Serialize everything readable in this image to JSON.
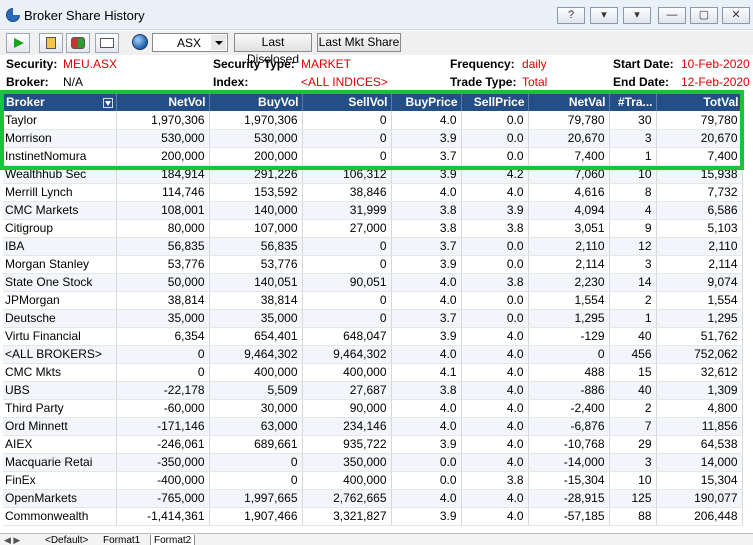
{
  "window": {
    "title": "Broker Share History",
    "buttons": [
      "?",
      "▾",
      "▾",
      "—",
      "▢",
      "✕"
    ]
  },
  "toolbar": {
    "exchange": "ASX",
    "last_disclosed": "Last Disclosed",
    "last_mkt_share": "Last Mkt Share"
  },
  "info": {
    "security_label": "Security:",
    "security": "MEU.ASX",
    "broker_label": "Broker:",
    "broker": "N/A",
    "security_type_label": "Security Type:",
    "security_type": "MARKET",
    "index_label": "Index:",
    "index": "<ALL INDICES>",
    "frequency_label": "Frequency:",
    "frequency": "daily",
    "trade_type_label": "Trade Type:",
    "trade_type": "Total",
    "start_date_label": "Start Date:",
    "start_date": "10-Feb-2020",
    "end_date_label": "End Date:",
    "end_date": "12-Feb-2020"
  },
  "table": {
    "columns": [
      "Broker",
      "NetVol",
      "BuyVol",
      "SellVol",
      "BuyPrice",
      "SellPrice",
      "NetVal",
      "#Tra...",
      "TotVal"
    ],
    "rows": [
      [
        "Taylor",
        "1,970,306",
        "1,970,306",
        "0",
        "4.0",
        "0.0",
        "79,780",
        "30",
        "79,780"
      ],
      [
        "Morrison",
        "530,000",
        "530,000",
        "0",
        "3.9",
        "0.0",
        "20,670",
        "3",
        "20,670"
      ],
      [
        "InstinetNomura",
        "200,000",
        "200,000",
        "0",
        "3.7",
        "0.0",
        "7,400",
        "1",
        "7,400"
      ],
      [
        "Wealthhub Sec",
        "184,914",
        "291,226",
        "106,312",
        "3.9",
        "4.2",
        "7,060",
        "10",
        "15,938"
      ],
      [
        "Merrill Lynch",
        "114,746",
        "153,592",
        "38,846",
        "4.0",
        "4.0",
        "4,616",
        "8",
        "7,732"
      ],
      [
        "CMC Markets",
        "108,001",
        "140,000",
        "31,999",
        "3.8",
        "3.9",
        "4,094",
        "4",
        "6,586"
      ],
      [
        "Citigroup",
        "80,000",
        "107,000",
        "27,000",
        "3.8",
        "3.8",
        "3,051",
        "9",
        "5,103"
      ],
      [
        "IBA",
        "56,835",
        "56,835",
        "0",
        "3.7",
        "0.0",
        "2,110",
        "12",
        "2,110"
      ],
      [
        "Morgan Stanley",
        "53,776",
        "53,776",
        "0",
        "3.9",
        "0.0",
        "2,114",
        "3",
        "2,114"
      ],
      [
        "State One Stock",
        "50,000",
        "140,051",
        "90,051",
        "4.0",
        "3.8",
        "2,230",
        "14",
        "9,074"
      ],
      [
        "JPMorgan",
        "38,814",
        "38,814",
        "0",
        "4.0",
        "0.0",
        "1,554",
        "2",
        "1,554"
      ],
      [
        "Deutsche",
        "35,000",
        "35,000",
        "0",
        "3.7",
        "0.0",
        "1,295",
        "1",
        "1,295"
      ],
      [
        "Virtu Financial",
        "6,354",
        "654,401",
        "648,047",
        "3.9",
        "4.0",
        "-129",
        "40",
        "51,762"
      ],
      [
        "<ALL BROKERS>",
        "0",
        "9,464,302",
        "9,464,302",
        "4.0",
        "4.0",
        "0",
        "456",
        "752,062"
      ],
      [
        "CMC Mkts",
        "0",
        "400,000",
        "400,000",
        "4.1",
        "4.0",
        "488",
        "15",
        "32,612"
      ],
      [
        "UBS",
        "-22,178",
        "5,509",
        "27,687",
        "3.8",
        "4.0",
        "-886",
        "40",
        "1,309"
      ],
      [
        "Third Party",
        "-60,000",
        "30,000",
        "90,000",
        "4.0",
        "4.0",
        "-2,400",
        "2",
        "4,800"
      ],
      [
        "Ord Minnett",
        "-171,146",
        "63,000",
        "234,146",
        "4.0",
        "4.0",
        "-6,876",
        "7",
        "11,856"
      ],
      [
        "AIEX",
        "-246,061",
        "689,661",
        "935,722",
        "3.9",
        "4.0",
        "-10,768",
        "29",
        "64,538"
      ],
      [
        "Macquarie Retai",
        "-350,000",
        "0",
        "350,000",
        "0.0",
        "4.0",
        "-14,000",
        "3",
        "14,000"
      ],
      [
        "FinEx",
        "-400,000",
        "0",
        "400,000",
        "0.0",
        "3.8",
        "-15,304",
        "10",
        "15,304"
      ],
      [
        "OpenMarkets",
        "-765,000",
        "1,997,665",
        "2,762,665",
        "4.0",
        "4.0",
        "-28,915",
        "125",
        "190,077"
      ],
      [
        "Commonwealth",
        "-1,414,361",
        "1,907,466",
        "3,321,827",
        "3.9",
        "4.0",
        "-57,185",
        "88",
        "206,448"
      ]
    ]
  },
  "tabs": [
    "<Default>",
    "Format1",
    "Format2"
  ],
  "colors": {
    "header_bg": "#244e86",
    "highlight": "#18c43a",
    "value_red": "#e00000"
  }
}
